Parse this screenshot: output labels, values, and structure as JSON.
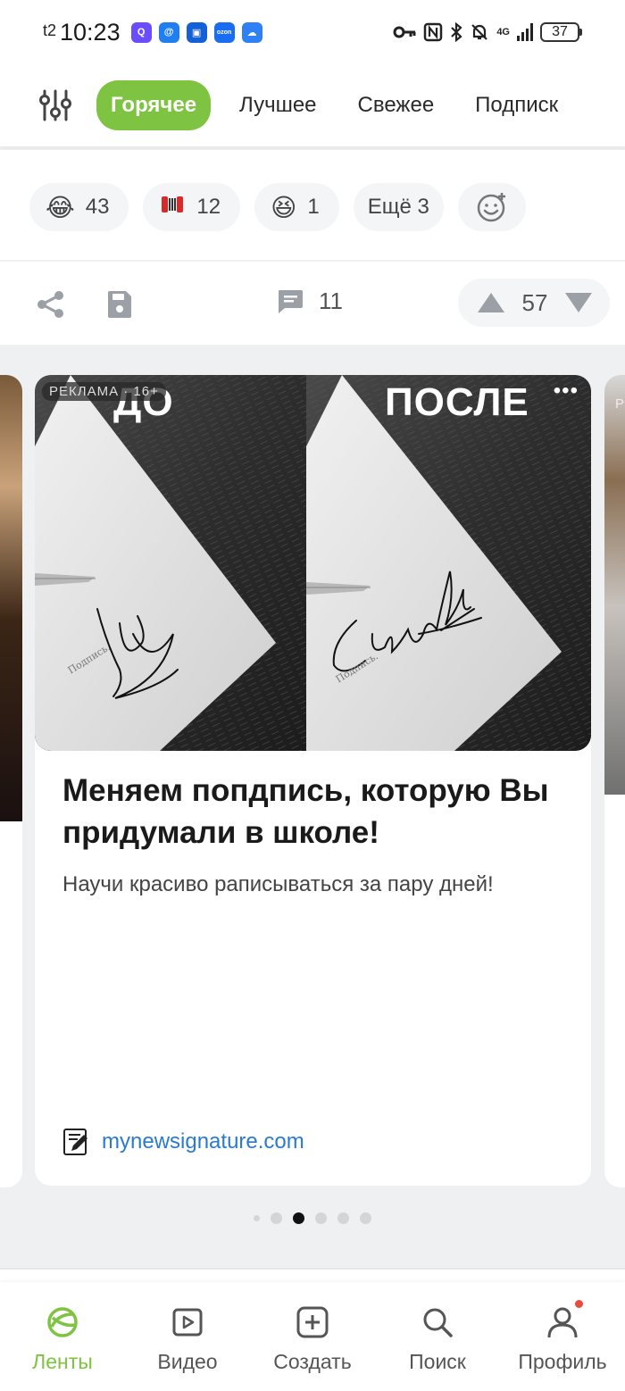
{
  "status_bar": {
    "carrier": "t2",
    "time": "10:23",
    "network": "4G",
    "battery": "37",
    "apps": [
      {
        "name": "Q",
        "color": "#6b4cff"
      },
      {
        "name": "@",
        "color": "#1f7ef0"
      },
      {
        "name": "▣",
        "color": "#1560d6"
      },
      {
        "name": "ozon",
        "color": "#1a6cf0"
      },
      {
        "name": "☁",
        "color": "#2f7ff5"
      }
    ]
  },
  "tabs": [
    "Горячее",
    "Лучшее",
    "Свежее",
    "Подписк"
  ],
  "post": {
    "reactions": [
      {
        "emoji": "😂",
        "count": "43"
      },
      {
        "emoji": "🪗",
        "count": "12"
      },
      {
        "emoji": "😆",
        "count": "1"
      }
    ],
    "more_reactions": "Ещё 3",
    "comments": "11",
    "rating": "57"
  },
  "ad": {
    "label": "РЕКЛАМА · 16+",
    "before": "ДО",
    "after": "ПОСЛЕ",
    "more": "•••",
    "title": "Меняем попдпись, которую Вы придумали в школе!",
    "description": "Научи красиво рaписываться за пару дней!",
    "link": "mynewsignature.com",
    "side_label": "Р",
    "paper_text": "Подпись."
  },
  "carousel": {
    "total": 6,
    "active": 2
  },
  "bottom_nav": [
    {
      "label": "Ленты",
      "icon": "feeds-icon"
    },
    {
      "label": "Видео",
      "icon": "video-icon"
    },
    {
      "label": "Создать",
      "icon": "create-icon"
    },
    {
      "label": "Поиск",
      "icon": "search-icon"
    },
    {
      "label": "Профиль",
      "icon": "profile-icon"
    }
  ],
  "colors": {
    "accent": "#7ec341",
    "link": "#2a7ad2",
    "notification": "#e74c3c"
  }
}
